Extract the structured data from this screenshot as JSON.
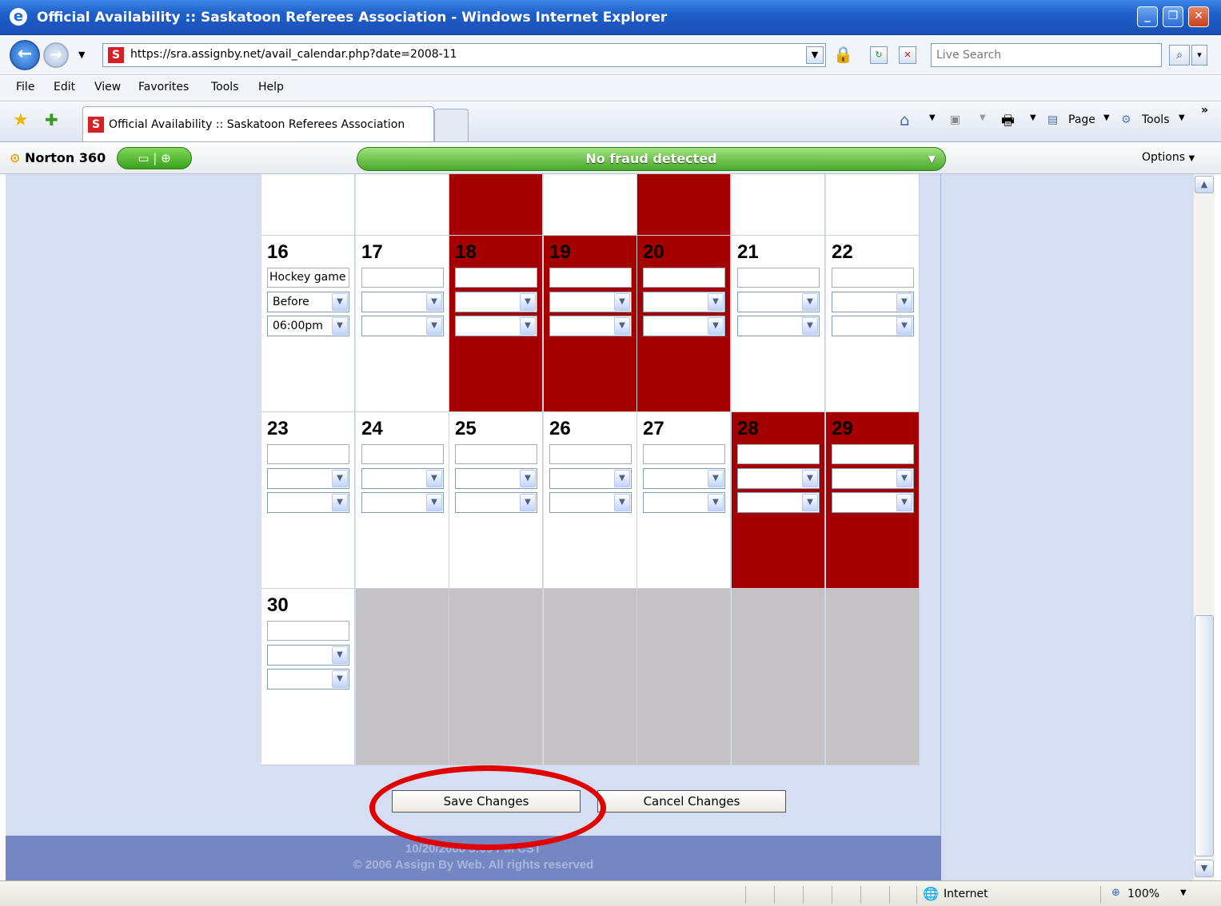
{
  "window": {
    "title": "Official Availability :: Saskatoon Referees Association - Windows Internet Explorer"
  },
  "address": {
    "url": "https://sra.assignby.net/avail_calendar.php?date=2008-11"
  },
  "search": {
    "placeholder": "Live Search"
  },
  "menu": [
    "File",
    "Edit",
    "View",
    "Favorites",
    "Tools",
    "Help"
  ],
  "tab": {
    "title": "Official Availability :: Saskatoon Referees Association"
  },
  "commandbar": {
    "page": "Page",
    "tools": "Tools"
  },
  "norton": {
    "product": "Norton 360",
    "status": "No fraud detected",
    "options": "Options"
  },
  "calendar": {
    "weeks": [
      {
        "days": [
          {
            "day": "",
            "state": "free"
          },
          {
            "day": "",
            "state": "free"
          },
          {
            "day": "",
            "state": "blocked"
          },
          {
            "day": "",
            "state": "free"
          },
          {
            "day": "",
            "state": "blocked"
          },
          {
            "day": "",
            "state": "free"
          },
          {
            "day": "",
            "state": "free"
          }
        ]
      },
      {
        "days": [
          {
            "day": "16",
            "state": "free",
            "note": "Hockey game",
            "when": "Before",
            "time": "06:00pm"
          },
          {
            "day": "17",
            "state": "free"
          },
          {
            "day": "18",
            "state": "blocked"
          },
          {
            "day": "19",
            "state": "blocked"
          },
          {
            "day": "20",
            "state": "blocked"
          },
          {
            "day": "21",
            "state": "free"
          },
          {
            "day": "22",
            "state": "free"
          }
        ]
      },
      {
        "days": [
          {
            "day": "23",
            "state": "free"
          },
          {
            "day": "24",
            "state": "free"
          },
          {
            "day": "25",
            "state": "free"
          },
          {
            "day": "26",
            "state": "free"
          },
          {
            "day": "27",
            "state": "free"
          },
          {
            "day": "28",
            "state": "blocked"
          },
          {
            "day": "29",
            "state": "blocked"
          }
        ]
      },
      {
        "days": [
          {
            "day": "30",
            "state": "free"
          },
          {
            "day": "",
            "state": "empty"
          },
          {
            "day": "",
            "state": "empty"
          },
          {
            "day": "",
            "state": "empty"
          },
          {
            "day": "",
            "state": "empty"
          },
          {
            "day": "",
            "state": "empty"
          },
          {
            "day": "",
            "state": "empty"
          }
        ]
      }
    ]
  },
  "buttons": {
    "save": "Save Changes",
    "cancel": "Cancel Changes"
  },
  "footer": {
    "timestamp": "10/20/2008 3:09 PM CST",
    "copyright": "© 2006 Assign By Web. All rights reserved"
  },
  "status": {
    "zone": "Internet",
    "zoom": "100%"
  },
  "colors": {
    "blocked": "#a50000",
    "empty": "#c4c2c4",
    "background": "#d6def4",
    "footer": "#7587c2",
    "highlight": "#e00000"
  }
}
